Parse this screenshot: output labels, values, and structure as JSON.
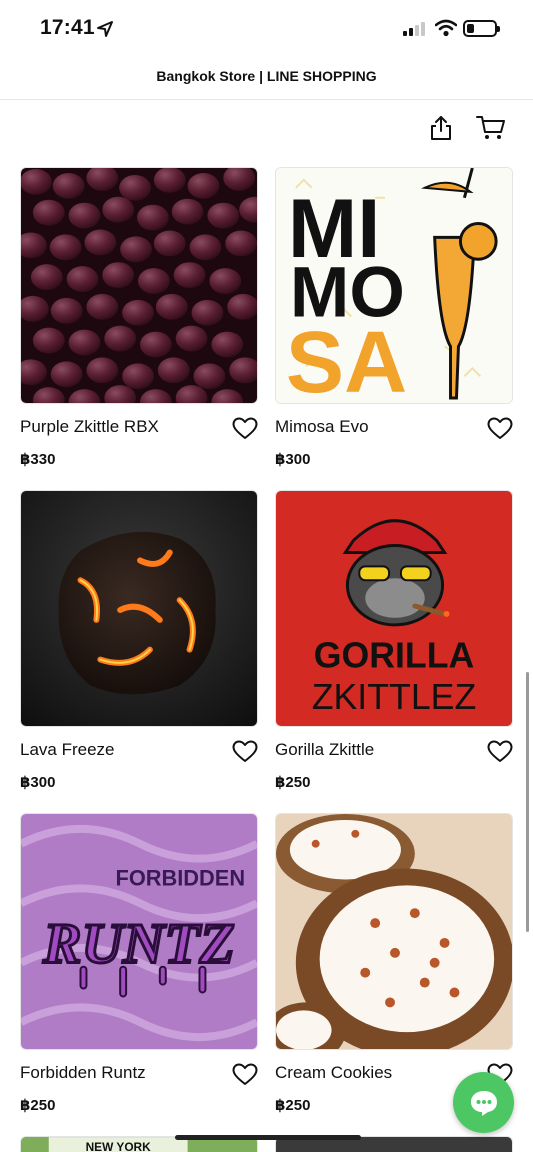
{
  "status_bar": {
    "time": "17:41"
  },
  "header": {
    "title": "Bangkok Store | LINE SHOPPING"
  },
  "toolbar": {
    "share_icon": "share-icon",
    "cart_icon": "cart-icon"
  },
  "products": [
    {
      "name": "Purple Zkittle RBX",
      "price": "฿330"
    },
    {
      "name": "Mimosa Evo",
      "price": "฿300",
      "image_text": [
        "MI",
        "MO",
        "SA"
      ]
    },
    {
      "name": "Lava Freeze",
      "price": "฿300"
    },
    {
      "name": "Gorilla Zkittle",
      "price": "฿250",
      "image_text": [
        "GORILLA",
        "ZKITTLEZ"
      ]
    },
    {
      "name": "Forbidden Runtz",
      "price": "฿250",
      "image_text": [
        "FORBIDDEN",
        "RUNTZ"
      ]
    },
    {
      "name": "Cream Cookies",
      "price": "฿250"
    }
  ],
  "partial_row_text": "NEW YORK",
  "colors": {
    "chat_fab": "#4cc764",
    "gorilla_bg": "#d32b23",
    "runtz_bg": "#b07cc6"
  }
}
